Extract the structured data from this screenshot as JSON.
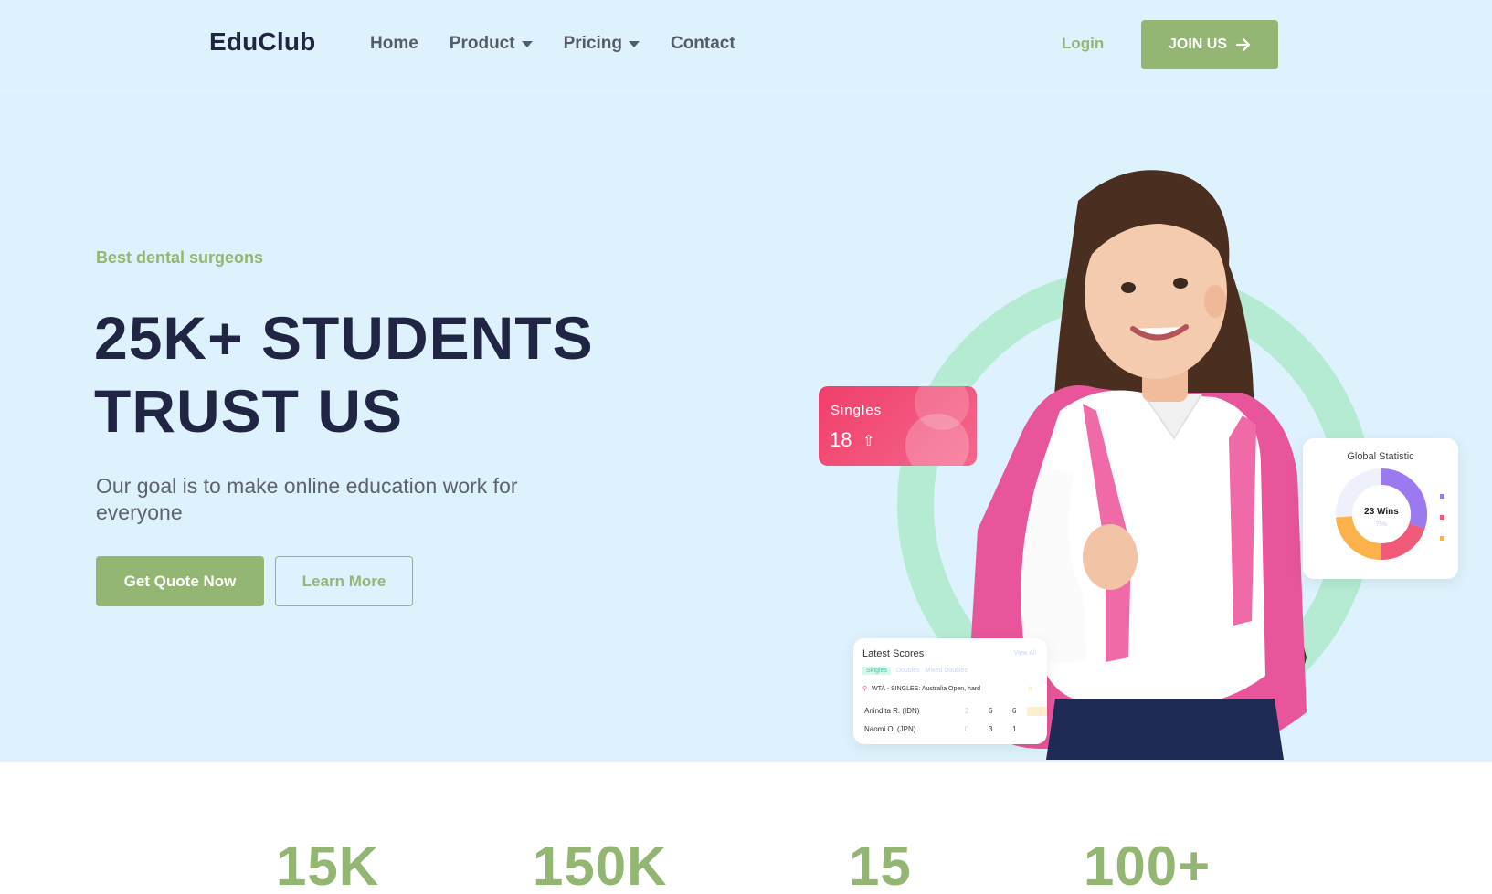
{
  "nav": {
    "logo": "EduClub",
    "items": [
      {
        "label": "Home",
        "dropdown": false
      },
      {
        "label": "Product",
        "dropdown": true
      },
      {
        "label": "Pricing",
        "dropdown": true
      },
      {
        "label": "Contact",
        "dropdown": false
      }
    ],
    "login_label": "Login",
    "join_label": "JOIN US"
  },
  "hero": {
    "tagline": "Best dental surgeons",
    "headline_line1": "25K+ STUDENTS",
    "headline_line2": "TRUST US",
    "subtext": "Our goal is to make online education work for everyone",
    "primary_button": "Get Quote Now",
    "secondary_button": "Learn More"
  },
  "singles_card": {
    "label": "Singles",
    "value": "18"
  },
  "global_card": {
    "title": "Global Statistic",
    "center_label": "23 Wins",
    "center_sub": "75%"
  },
  "scores_card": {
    "title": "Latest Scores",
    "view_all": "View All",
    "tabs": [
      "Singles",
      "Doubles",
      "Mixed Doubles"
    ],
    "match": "WTA - SINGLES: Australia Open, hard",
    "rows": [
      {
        "player": "Anindita R. (IDN)",
        "s1": "2",
        "s2": "6",
        "s3": "6"
      },
      {
        "player": "Naomi O. (JPN)",
        "s1": "0",
        "s2": "3",
        "s3": "1"
      }
    ]
  },
  "stats": [
    "15K",
    "150K",
    "15",
    "100+"
  ],
  "colors": {
    "accent": "#93b673",
    "hero_bg": "#ddf2fc",
    "heading": "#1f2542",
    "ring": "#b4ebd2",
    "singles": "#ef3f6b"
  }
}
